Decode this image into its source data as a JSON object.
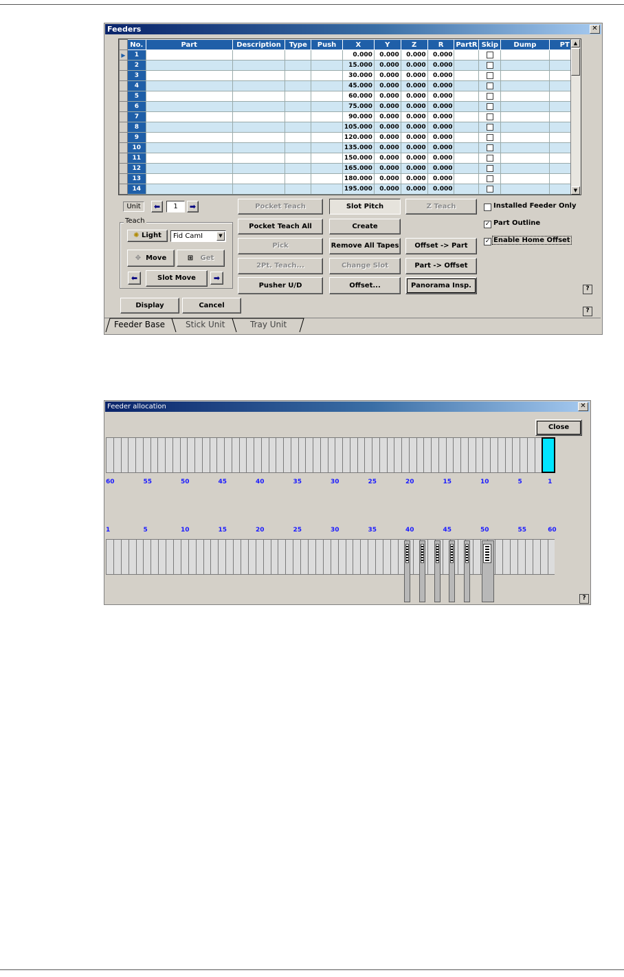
{
  "feeders": {
    "title": "Feeders",
    "columns": [
      "No.",
      "Part",
      "Description",
      "Type",
      "Push",
      "X",
      "Y",
      "Z",
      "R",
      "PartR",
      "Skip",
      "Dump",
      "PT"
    ],
    "rows": [
      {
        "no": "1",
        "x": "0.000",
        "y": "0.000",
        "z": "0.000",
        "r": "0.000"
      },
      {
        "no": "2",
        "x": "15.000",
        "y": "0.000",
        "z": "0.000",
        "r": "0.000"
      },
      {
        "no": "3",
        "x": "30.000",
        "y": "0.000",
        "z": "0.000",
        "r": "0.000"
      },
      {
        "no": "4",
        "x": "45.000",
        "y": "0.000",
        "z": "0.000",
        "r": "0.000"
      },
      {
        "no": "5",
        "x": "60.000",
        "y": "0.000",
        "z": "0.000",
        "r": "0.000"
      },
      {
        "no": "6",
        "x": "75.000",
        "y": "0.000",
        "z": "0.000",
        "r": "0.000"
      },
      {
        "no": "7",
        "x": "90.000",
        "y": "0.000",
        "z": "0.000",
        "r": "0.000"
      },
      {
        "no": "8",
        "x": "105.000",
        "y": "0.000",
        "z": "0.000",
        "r": "0.000"
      },
      {
        "no": "9",
        "x": "120.000",
        "y": "0.000",
        "z": "0.000",
        "r": "0.000"
      },
      {
        "no": "10",
        "x": "135.000",
        "y": "0.000",
        "z": "0.000",
        "r": "0.000"
      },
      {
        "no": "11",
        "x": "150.000",
        "y": "0.000",
        "z": "0.000",
        "r": "0.000"
      },
      {
        "no": "12",
        "x": "165.000",
        "y": "0.000",
        "z": "0.000",
        "r": "0.000"
      },
      {
        "no": "13",
        "x": "180.000",
        "y": "0.000",
        "z": "0.000",
        "r": "0.000"
      },
      {
        "no": "14",
        "x": "195.000",
        "y": "0.000",
        "z": "0.000",
        "r": "0.000"
      }
    ],
    "unit_label": "Unit",
    "unit_value": "1",
    "teach_group": "Teach",
    "light_label": "Light",
    "camera_select": "Fid CamI",
    "move_label": "Move",
    "get_label": "Get",
    "slot_move_label": "Slot Move",
    "buttons": {
      "pocket_teach": "Pocket Teach",
      "slot_pitch": "Slot Pitch",
      "z_teach": "Z Teach",
      "pocket_teach_all": "Pocket Teach All",
      "create": "Create",
      "pick": "Pick",
      "remove_all_tapes": "Remove All Tapes",
      "offset_to_part": "Offset -> Part",
      "two_pt_teach": "2Pt. Teach...",
      "change_slot": "Change Slot",
      "part_to_offset": "Part -> Offset",
      "pusher": "Pusher U/D",
      "offset": "Offset...",
      "panorama": "Panorama Insp.",
      "display": "Display",
      "cancel": "Cancel"
    },
    "checkboxes": [
      {
        "label": "Installed Feeder Only",
        "checked": false
      },
      {
        "label": "Part Outline",
        "checked": true
      },
      {
        "label": "Enable Home Offset",
        "checked": true
      }
    ],
    "tabs": [
      "Feeder Base",
      "Stick Unit",
      "Tray Unit"
    ],
    "help": "?"
  },
  "allocation": {
    "title": "Feeder allocation",
    "close_label": "Close",
    "top_numbers": [
      "60",
      "55",
      "50",
      "45",
      "40",
      "35",
      "30",
      "25",
      "20",
      "15",
      "10",
      "5",
      "1"
    ],
    "bottom_numbers": [
      "1",
      "5",
      "10",
      "15",
      "20",
      "25",
      "30",
      "35",
      "40",
      "45",
      "50",
      "55",
      "60"
    ],
    "help": "?"
  },
  "colors": {
    "header_blue": "#1f5fa8",
    "alt_row": "#cfe6f3",
    "selected_slot": "#00e5ff",
    "number_blue": "#1a1aff"
  }
}
